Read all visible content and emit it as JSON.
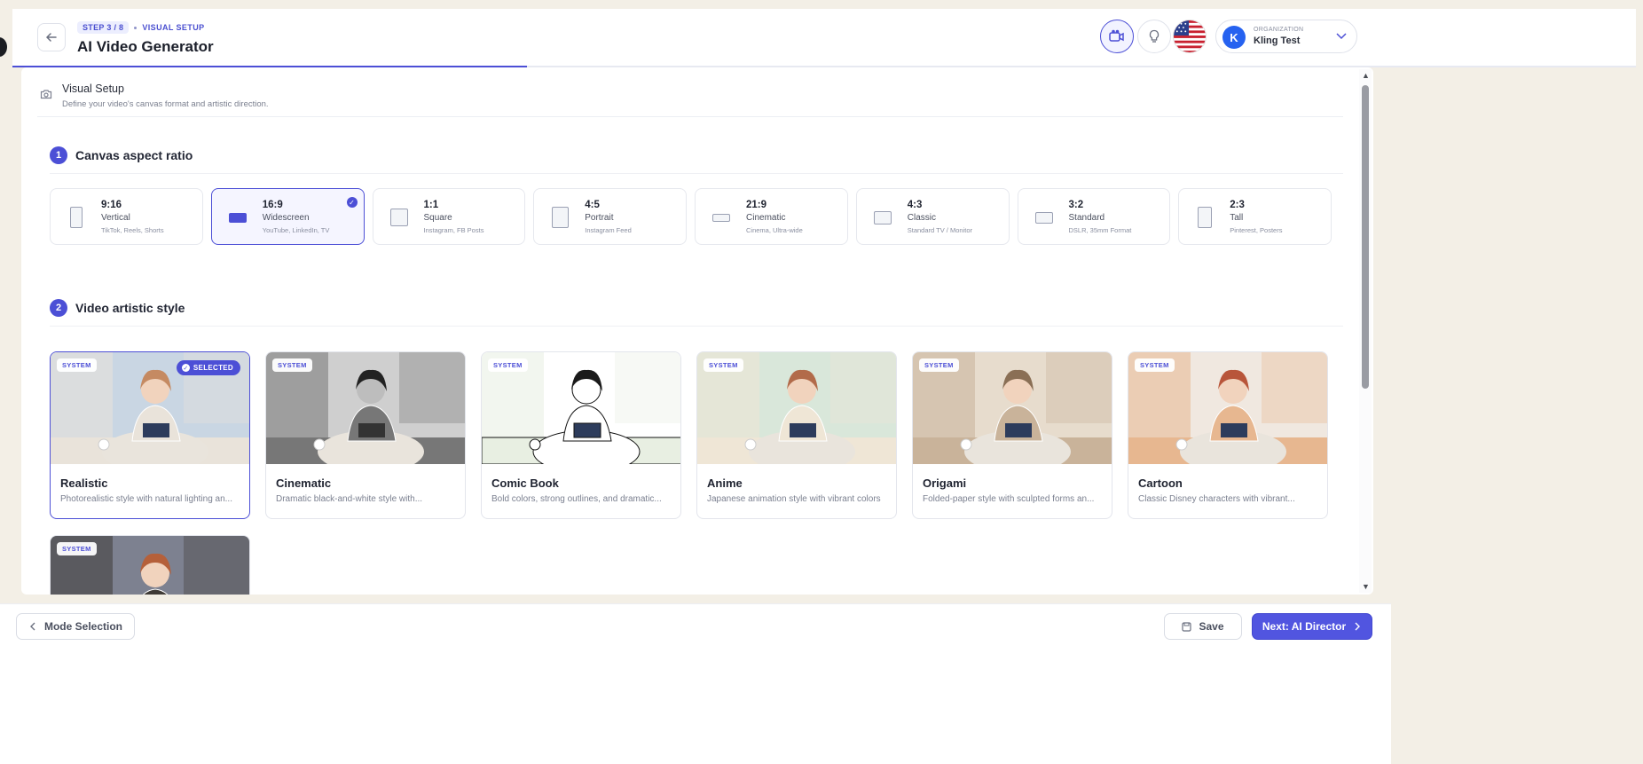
{
  "header": {
    "step_badge": "STEP 3 / 8",
    "step_label": "VISUAL SETUP",
    "title": "AI Video Generator",
    "progress_fraction": 0.317,
    "organization": {
      "caption": "ORGANIZATION",
      "avatar_initial": "K",
      "name": "Kling Test"
    },
    "icons": [
      "back-arrow-icon",
      "video-camera-icon",
      "lightbulb-icon",
      "us-flag-icon",
      "chevron-down-icon"
    ]
  },
  "section": {
    "title": "Visual Setup",
    "subtitle": "Define your video's canvas format and artistic direction."
  },
  "aspect": {
    "number": "1",
    "title": "Canvas aspect ratio",
    "selected": "16:9",
    "items": [
      {
        "ratio": "9:16",
        "name": "Vertical",
        "uses": "TikTok, Reels, Shorts"
      },
      {
        "ratio": "16:9",
        "name": "Widescreen",
        "uses": "YouTube, LinkedIn, TV"
      },
      {
        "ratio": "1:1",
        "name": "Square",
        "uses": "Instagram, FB Posts"
      },
      {
        "ratio": "4:5",
        "name": "Portrait",
        "uses": "Instagram Feed"
      },
      {
        "ratio": "21:9",
        "name": "Cinematic",
        "uses": "Cinema, Ultra-wide"
      },
      {
        "ratio": "4:3",
        "name": "Classic",
        "uses": "Standard TV / Monitor"
      },
      {
        "ratio": "3:2",
        "name": "Standard",
        "uses": "DSLR, 35mm Format"
      },
      {
        "ratio": "2:3",
        "name": "Tall",
        "uses": "Pinterest, Posters"
      }
    ]
  },
  "style": {
    "number": "2",
    "title": "Video artistic style",
    "system_badge": "SYSTEM",
    "selected_badge": "SELECTED",
    "selected": "Realistic",
    "items": [
      {
        "name": "Realistic",
        "desc": "Photorealistic style with natural lighting an...",
        "palette": [
          "#c9d6e3",
          "#e9e3da",
          "#c58a62"
        ]
      },
      {
        "name": "Cinematic",
        "desc": "Dramatic black-and-white style with...",
        "palette": [
          "#cfcfcf",
          "#777777",
          "#222222"
        ]
      },
      {
        "name": "Comic Book",
        "desc": "Bold colors, strong outlines, and dramatic...",
        "palette": [
          "#ffffff",
          "#e8efe2",
          "#1a1a1a"
        ]
      },
      {
        "name": "Anime",
        "desc": "Japanese animation style with vibrant colors",
        "palette": [
          "#d9e7da",
          "#efe6d6",
          "#b26b4a"
        ]
      },
      {
        "name": "Origami",
        "desc": "Folded-paper style with sculpted forms an...",
        "palette": [
          "#e7dccd",
          "#c9b39a",
          "#8a6f55"
        ]
      },
      {
        "name": "Cartoon",
        "desc": "Classic Disney characters with vibrant...",
        "palette": [
          "#f0e8e0",
          "#e7b790",
          "#b8553a"
        ]
      },
      {
        "name": "",
        "desc": "",
        "palette": [
          "#7d8190",
          "#3e3a36",
          "#b5603a"
        ]
      }
    ]
  },
  "footer": {
    "mode_label": "Mode Selection",
    "save_label": "Save",
    "next_label": "Next: AI Director"
  },
  "colors": {
    "accent": "#4c4fd6",
    "page_bg": "#f3efe6",
    "next_button": "#5155e0"
  }
}
